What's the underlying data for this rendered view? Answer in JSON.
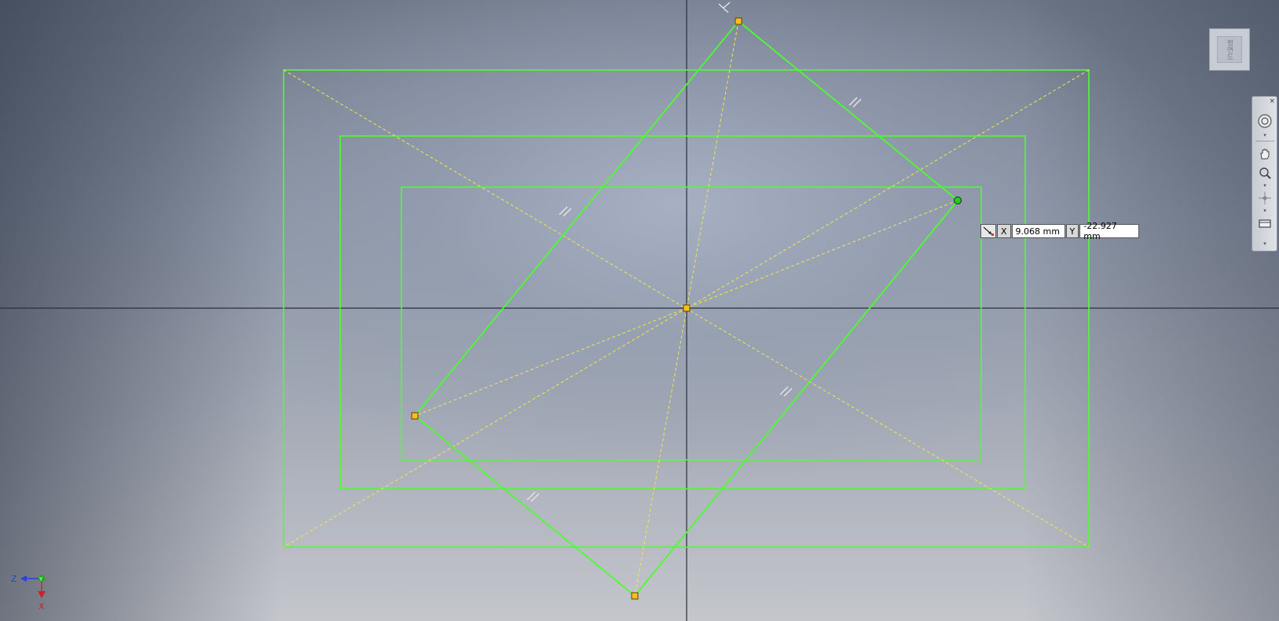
{
  "sketch": {
    "colors": {
      "geometry": "#4bff2e",
      "construction": "#f2e84a",
      "axes": "#2a2f3a",
      "point_fill": "#ffbf1a",
      "active_point": "#22cc22"
    }
  },
  "coordinate_input": {
    "x_label": "X",
    "x_value": "9.068 mm",
    "y_label": "Y",
    "y_value": "-22.927 mm",
    "icon": "dimension-arrow-icon"
  },
  "viewcube": {
    "face_label": "평면도"
  },
  "navigation_bar": {
    "close": "×",
    "tools": [
      "steering-wheel-icon",
      "pan-hand-icon",
      "zoom-icon",
      "orbit-icon",
      "view-face-icon"
    ],
    "expand": "▾"
  },
  "triad": {
    "z_label": "Z",
    "y_label": "Y",
    "x_label": "X",
    "z_color": "#2244dd",
    "y_color": "#22aa22",
    "x_color": "#cc2222"
  }
}
